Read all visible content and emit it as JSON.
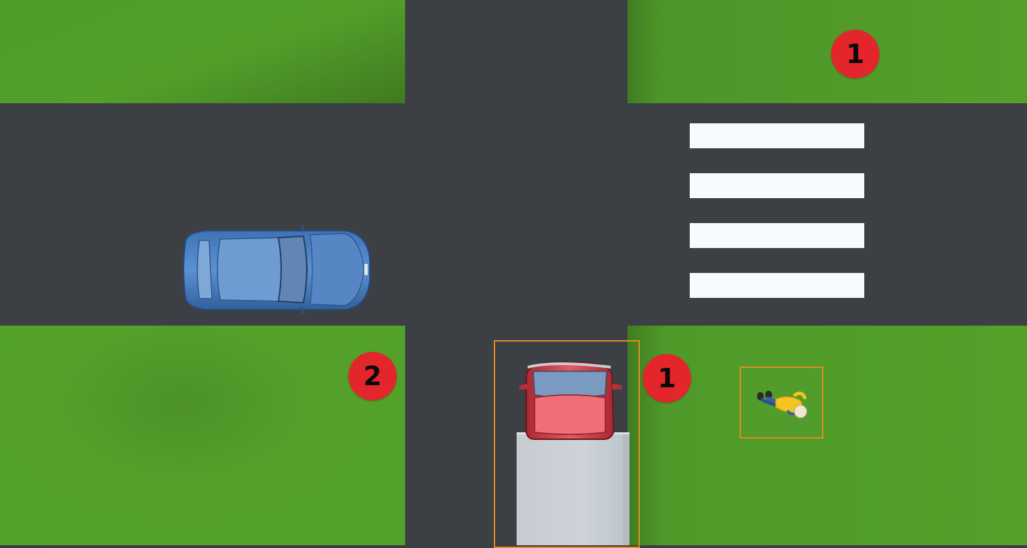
{
  "scene": {
    "markers": [
      {
        "id": "marker-top-right",
        "label": "1"
      },
      {
        "id": "marker-bottom-left",
        "label": "2"
      },
      {
        "id": "marker-bottom-center",
        "label": "1"
      }
    ],
    "vehicles": [
      {
        "id": "blue-car",
        "color": "#4a7fc1"
      },
      {
        "id": "red-truck-cab",
        "color": "#d84a55"
      },
      {
        "id": "truck-cargo",
        "color": "#c9cfd5"
      }
    ],
    "pedestrian": {
      "id": "lying-person",
      "shirt_color": "#f2c51f"
    },
    "selection_color": "#e48a22",
    "crosswalk_stripes": 4
  }
}
